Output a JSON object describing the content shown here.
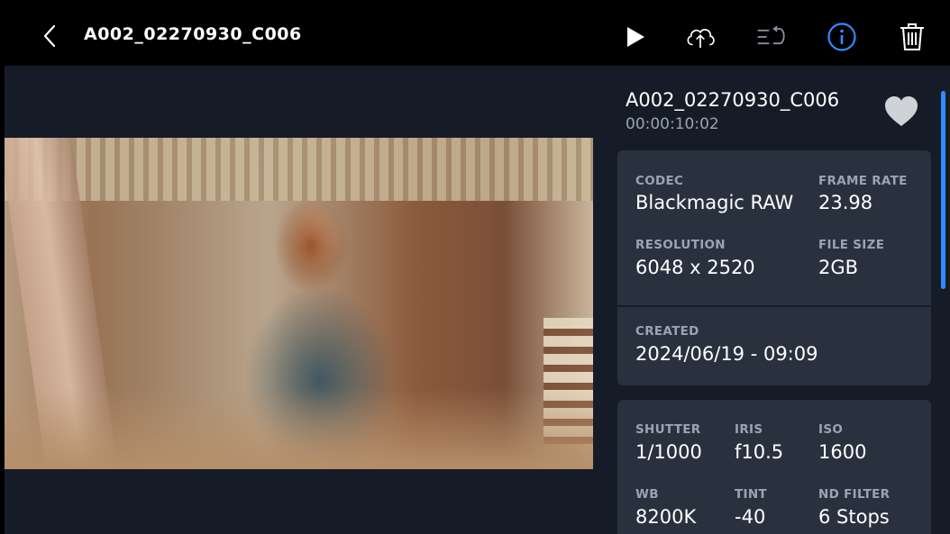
{
  "header": {
    "clip_name": "A002_02270930_C006",
    "icons": [
      "back-chevron-icon",
      "play-icon",
      "cloud-upload-icon",
      "sort-return-icon",
      "info-icon",
      "trash-icon"
    ],
    "accent_color": "#2f8cff"
  },
  "viewer": {
    "image_description_icon": "video-frame"
  },
  "panel": {
    "clip_name": "A002_02270930_C006",
    "duration": "00:00:10:02",
    "favorite_icon": "heart-icon",
    "media_card": {
      "codec_label": "CODEC",
      "codec_value": "Blackmagic RAW",
      "frame_rate_label": "FRAME RATE",
      "frame_rate_value": "23.98",
      "resolution_label": "RESOLUTION",
      "resolution_value": "6048 x 2520",
      "file_size_label": "FILE SIZE",
      "file_size_value": "2GB"
    },
    "created_card": {
      "created_label": "CREATED",
      "created_value": "2024/06/19 - 09:09"
    },
    "camera_card": {
      "shutter_label": "SHUTTER",
      "shutter_value": "1/1000",
      "iris_label": "IRIS",
      "iris_value": "f10.5",
      "iso_label": "ISO",
      "iso_value": "1600",
      "wb_label": "WB",
      "wb_value": "8200K",
      "tint_label": "TINT",
      "tint_value": "-40",
      "nd_label": "ND FILTER",
      "nd_value": "6 Stops"
    }
  }
}
